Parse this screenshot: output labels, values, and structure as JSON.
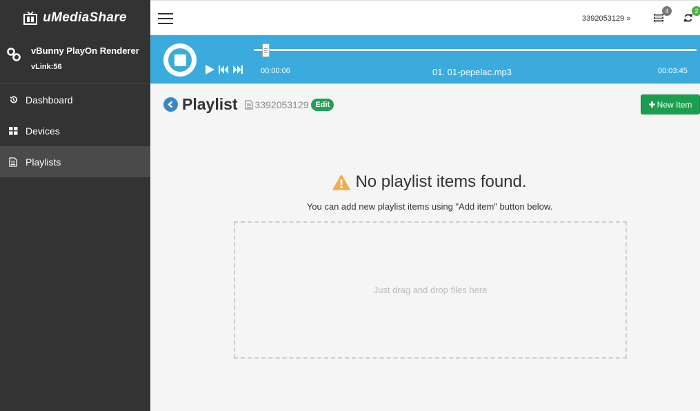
{
  "app": {
    "logo_text": "uMediaShare"
  },
  "renderer": {
    "name": "vBunny PlayOn Renderer",
    "vlink": "vLink:56"
  },
  "sidebar": {
    "items": [
      {
        "label": "Dashboard",
        "icon": "history-icon"
      },
      {
        "label": "Devices",
        "icon": "grid-icon"
      },
      {
        "label": "Playlists",
        "icon": "document-icon",
        "active": true
      }
    ]
  },
  "header": {
    "user_link": "3392053129 »",
    "queue_badge": "4",
    "sync_badge": "2",
    "queue_badge_color": "#777777",
    "sync_badge_color": "#4cae4c"
  },
  "player": {
    "accent": "#3aabdc",
    "current_time": "00:00:06",
    "total_time": "00:03:45",
    "track": "01. 01-pepelac.mp3",
    "progress_fraction": 0.027
  },
  "page": {
    "title": "Playlist",
    "playlist_id": "3392053129",
    "edit_label": "Edit",
    "new_item_label": "New Item",
    "empty_title": "No playlist items found.",
    "empty_subtitle": "You can add new playlist items using \"Add item\" button below.",
    "dropzone_text": "Just drag and drop files here"
  }
}
